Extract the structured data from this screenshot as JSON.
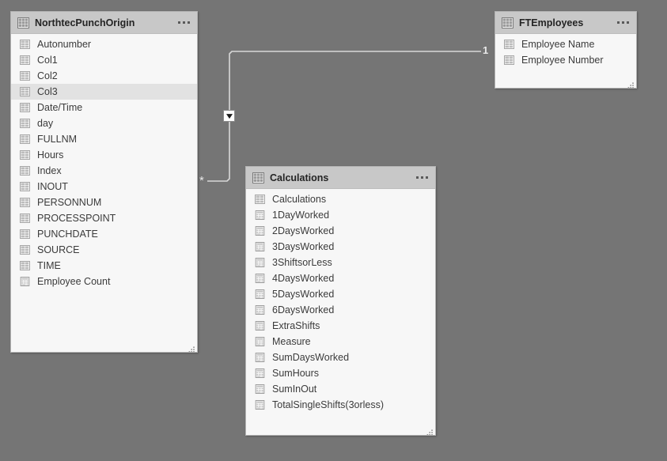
{
  "canvas": {
    "background_color": "#757575",
    "view": "model-diagram"
  },
  "tables": [
    {
      "id": "northtec",
      "name": "NorthtecPunchOrigin",
      "menu_label": "more-options",
      "fields": [
        {
          "label": "Autonumber",
          "icon": "column-icon",
          "highlighted": false
        },
        {
          "label": "Col1",
          "icon": "column-icon",
          "highlighted": false
        },
        {
          "label": "Col2",
          "icon": "column-icon",
          "highlighted": false
        },
        {
          "label": "Col3",
          "icon": "column-icon",
          "highlighted": true
        },
        {
          "label": "Date/Time",
          "icon": "column-icon",
          "highlighted": false
        },
        {
          "label": "day",
          "icon": "column-icon",
          "highlighted": false
        },
        {
          "label": "FULLNM",
          "icon": "column-icon",
          "highlighted": false
        },
        {
          "label": "Hours",
          "icon": "column-icon",
          "highlighted": false
        },
        {
          "label": "Index",
          "icon": "column-icon",
          "highlighted": false
        },
        {
          "label": "INOUT",
          "icon": "column-icon",
          "highlighted": false
        },
        {
          "label": "PERSONNUM",
          "icon": "column-icon",
          "highlighted": false
        },
        {
          "label": "PROCESSPOINT",
          "icon": "column-icon",
          "highlighted": false
        },
        {
          "label": "PUNCHDATE",
          "icon": "column-icon",
          "highlighted": false
        },
        {
          "label": "SOURCE",
          "icon": "column-icon",
          "highlighted": false
        },
        {
          "label": "TIME",
          "icon": "column-icon",
          "highlighted": false
        },
        {
          "label": "Employee Count",
          "icon": "measure-icon",
          "highlighted": false
        }
      ]
    },
    {
      "id": "ftemp",
      "name": "FTEmployees",
      "menu_label": "more-options",
      "fields": [
        {
          "label": "Employee Name",
          "icon": "column-icon",
          "highlighted": false
        },
        {
          "label": "Employee Number",
          "icon": "column-icon",
          "highlighted": false
        }
      ]
    },
    {
      "id": "calc",
      "name": "Calculations",
      "menu_label": "more-options",
      "fields": [
        {
          "label": "Calculations",
          "icon": "column-icon",
          "highlighted": false
        },
        {
          "label": "1DayWorked",
          "icon": "measure-icon",
          "highlighted": false
        },
        {
          "label": "2DaysWorked",
          "icon": "measure-icon",
          "highlighted": false
        },
        {
          "label": "3DaysWorked",
          "icon": "measure-icon",
          "highlighted": false
        },
        {
          "label": "3ShiftsorLess",
          "icon": "measure-icon",
          "highlighted": false
        },
        {
          "label": "4DaysWorked",
          "icon": "measure-icon",
          "highlighted": false
        },
        {
          "label": "5DaysWorked",
          "icon": "measure-icon",
          "highlighted": false
        },
        {
          "label": "6DaysWorked",
          "icon": "measure-icon",
          "highlighted": false
        },
        {
          "label": "ExtraShifts",
          "icon": "measure-icon",
          "highlighted": false
        },
        {
          "label": "Measure",
          "icon": "measure-icon",
          "highlighted": false
        },
        {
          "label": "SumDaysWorked",
          "icon": "measure-icon",
          "highlighted": false
        },
        {
          "label": "SumHours",
          "icon": "measure-icon",
          "highlighted": false
        },
        {
          "label": "SumInOut",
          "icon": "measure-icon",
          "highlighted": false
        },
        {
          "label": "TotalSingleShifts(3orless)",
          "icon": "measure-icon",
          "highlighted": false
        }
      ]
    }
  ],
  "relationship": {
    "from_table": "NorthtecPunchOrigin",
    "to_table": "FTEmployees",
    "many_cardinality": "*",
    "one_cardinality": "1",
    "cross_filter_direction": "single",
    "arrow_icon": "filter-direction-arrow-icon",
    "line_color": "#d8d8d8"
  }
}
